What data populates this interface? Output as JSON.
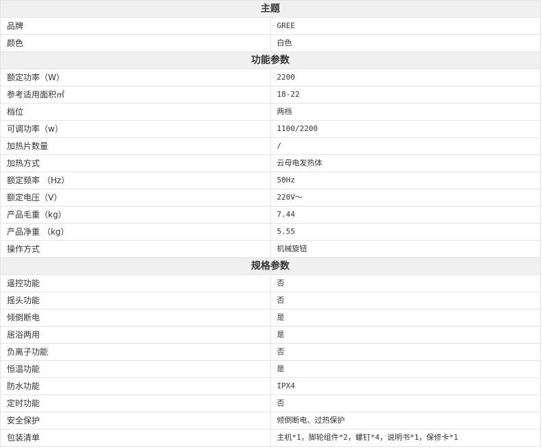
{
  "sections": [
    {
      "title": "主题",
      "rows": [
        {
          "k": "品牌",
          "v": "GREE"
        },
        {
          "k": "颜色",
          "v": "白色"
        }
      ]
    },
    {
      "title": "功能参数",
      "rows": [
        {
          "k": "额定功率（W）",
          "v": "2200"
        },
        {
          "k": "参考适用面积㎡",
          "v": "18-22"
        },
        {
          "k": "档位",
          "v": "两档"
        },
        {
          "k": "可调功率（w）",
          "v": "1100/2200"
        },
        {
          "k": "加热片数量",
          "v": "/"
        },
        {
          "k": "加热方式",
          "v": "云母电发热体"
        },
        {
          "k": "额定频率 （Hz）",
          "v": "50Hz"
        },
        {
          "k": "额定电压（V）",
          "v": "220V～"
        },
        {
          "k": "产品毛重（kg）",
          "v": "7.44"
        },
        {
          "k": "产品净重 （kg）",
          "v": "5.55"
        },
        {
          "k": "操作方式",
          "v": "机械旋钮"
        }
      ]
    },
    {
      "title": "规格参数",
      "rows": [
        {
          "k": "遥控功能",
          "v": "否"
        },
        {
          "k": "摇头功能",
          "v": "否"
        },
        {
          "k": "倾倒断电",
          "v": "是"
        },
        {
          "k": "居浴两用",
          "v": "是"
        },
        {
          "k": "负离子功能",
          "v": "否"
        },
        {
          "k": "恒温功能",
          "v": "是"
        },
        {
          "k": "防水功能",
          "v": "IPX4"
        },
        {
          "k": "定时功能",
          "v": "否"
        },
        {
          "k": "安全保护",
          "v": "倾倒断电、过热保护"
        },
        {
          "k": "包装清单",
          "v": "主机*1，脚轮组件*2，螺钉*4，说明书*1，保修卡*1"
        }
      ]
    }
  ]
}
